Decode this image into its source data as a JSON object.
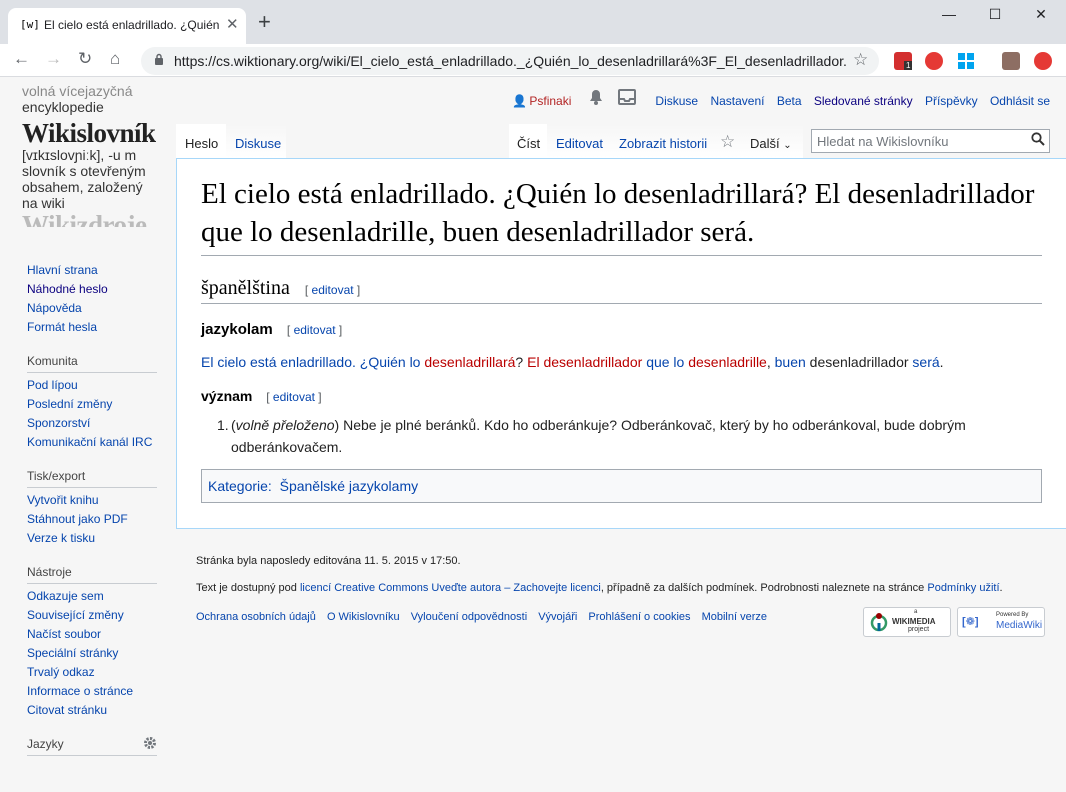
{
  "browser": {
    "tab_favicon": "[w]",
    "tab_title": "El cielo está enladrillado. ¿Quién lo desenladrillará?",
    "tab_close": "✕",
    "new_tab": "+",
    "url": "https://cs.wiktionary.org/wiki/El_cielo_está_enladrillado._¿Quién_lo_desenladrillará%3F_El_desenladrillador...",
    "back": "←",
    "forward": "→",
    "reload": "↻",
    "home": "⌂",
    "star": "☆",
    "minimize": "—",
    "maximize": "☐",
    "close": "✕",
    "extension_badge": "1"
  },
  "logo": {
    "line1": "volná vícejazyčná",
    "line2": "encyklopedie",
    "title": "Wikislovník",
    "pron": "[vɪkɪslovɲiːk], -u m",
    "desc1": "slovník s otevřeným",
    "desc2": "obsahem, založený",
    "desc3": "na wiki",
    "next": "Wikizdroje"
  },
  "personal": {
    "user": "Psfinaki",
    "talk": "Diskuse",
    "prefs": "Nastavení",
    "beta": "Beta",
    "watchlist": "Sledované stránky",
    "contribs": "Příspěvky",
    "logout": "Odhlásit se"
  },
  "tabs": {
    "page": "Heslo",
    "talk": "Diskuse",
    "read": "Číst",
    "edit": "Editovat",
    "history": "Zobrazit historii",
    "more": "Další"
  },
  "search": {
    "placeholder": "Hledat na Wikislovníku"
  },
  "article": {
    "title": "El cielo está enladrillado. ¿Quién lo desenladrillará? El desenladrillador que lo desenladrille, buen desenladrillador será.",
    "language": "španělština",
    "edit": "editovat",
    "section": "jazykolam",
    "phrase": {
      "p1": "El cielo está enladrillado.",
      "p2": "¿Quién lo",
      "p3": "desenladrillará",
      "p4": "?",
      "p5": "El desenladrillador",
      "p6": "que lo",
      "p7": "desenladrille",
      "p8": ",",
      "p9": "buen",
      "p10": "desenladrillador",
      "p11": "será",
      "p12": "."
    },
    "meaning": "význam",
    "def_num": "1.",
    "def_note": "volně přeloženo",
    "def_text": "Nebe je plné beránků. Kdo ho odberánkuje? Odberánkovač, který by ho odberánkoval, bude dobrým odberánkovačem.",
    "cat_label": "Kategorie:",
    "cat_value": "Španělské jazykolamy"
  },
  "sidebar": {
    "main": [
      "Hlavní strana",
      "Náhodné heslo",
      "Nápověda",
      "Formát hesla"
    ],
    "community_head": "Komunita",
    "community": [
      "Pod lípou",
      "Poslední změny",
      "Sponzorství",
      "Komunikační kanál IRC"
    ],
    "print_head": "Tisk/export",
    "print": [
      "Vytvořit knihu",
      "Stáhnout jako PDF",
      "Verze k tisku"
    ],
    "tools_head": "Nástroje",
    "tools": [
      "Odkazuje sem",
      "Související změny",
      "Načíst soubor",
      "Speciální stránky",
      "Trvalý odkaz",
      "Informace o stránce",
      "Citovat stránku"
    ],
    "lang_head": "Jazyky"
  },
  "footer": {
    "edited": "Stránka byla naposledy editována 11. 5. 2015 v 17:50.",
    "license_pre": "Text je dostupný pod",
    "license_link": "licencí Creative Commons Uveďte autora – Zachovejte licenci",
    "license_mid": ", případně za dalších podmínek. Podrobnosti naleznete na stránce",
    "terms_link": "Podmínky užití",
    "license_end": ".",
    "links": [
      "Ochrana osobních údajů",
      "O Wikislovníku",
      "Vyloučení odpovědnosti",
      "Vývojáři",
      "Prohlášení o cookies",
      "Mobilní verze"
    ],
    "wikimedia_a": "a",
    "wikimedia": "WIKIMEDIA",
    "wikimedia_sub": "project",
    "powered_by": "Powered By",
    "mediawiki": "MediaWiki"
  }
}
